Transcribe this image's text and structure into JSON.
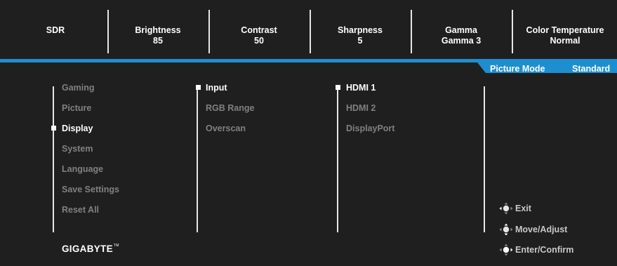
{
  "status_bar": [
    {
      "label": "SDR",
      "value": ""
    },
    {
      "label": "Brightness",
      "value": "85"
    },
    {
      "label": "Contrast",
      "value": "50"
    },
    {
      "label": "Sharpness",
      "value": "5"
    },
    {
      "label": "Gamma",
      "value": "Gamma 3"
    },
    {
      "label": "Color Temperature",
      "value": "Normal"
    }
  ],
  "picture_mode": {
    "label": "Picture Mode",
    "value": "Standard"
  },
  "menu": {
    "main": [
      "Gaming",
      "Picture",
      "Display",
      "System",
      "Language",
      "Save Settings",
      "Reset All"
    ],
    "main_selected": "Display",
    "sub": [
      "Input",
      "RGB Range",
      "Overscan"
    ],
    "sub_selected": "Input",
    "options": [
      "HDMI 1",
      "HDMI 2",
      "DisplayPort"
    ],
    "options_selected": "HDMI 1"
  },
  "nav_hints": {
    "exit": "Exit",
    "move_adjust": "Move/Adjust",
    "enter_confirm": "Enter/Confirm"
  },
  "brand": {
    "name": "GIGABYTE",
    "mark": "TM"
  },
  "colors": {
    "accent": "#1d8fd0",
    "background": "#1f1f20",
    "inactive_text": "#808080"
  }
}
